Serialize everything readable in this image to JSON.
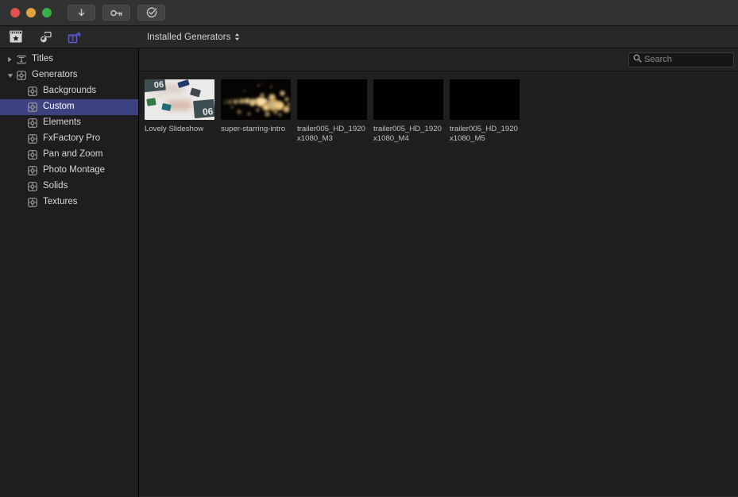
{
  "window": {
    "traffic_lights": [
      {
        "name": "close",
        "color": "#e0524a"
      },
      {
        "name": "minimize",
        "color": "#dfa23c"
      },
      {
        "name": "zoom",
        "color": "#36b14a"
      }
    ],
    "toolbar_buttons": [
      {
        "name": "download-button",
        "icon": "download-arrow-icon"
      },
      {
        "name": "license-key-button",
        "icon": "key-icon"
      },
      {
        "name": "check-updates-button",
        "icon": "check-circle-icon"
      }
    ]
  },
  "subbar": {
    "icons": [
      {
        "name": "clapboard-star-icon",
        "label": "Effects Browser"
      },
      {
        "name": "music-photo-icon",
        "label": "Music and Photos"
      },
      {
        "name": "titles-generators-icon",
        "label": "Titles and Generators"
      }
    ],
    "title": "Installed Generators",
    "popup_indicator": "chevron-updown-icon"
  },
  "search": {
    "placeholder": "Search",
    "value": "",
    "icon": "search-icon"
  },
  "sidebar": {
    "items": [
      {
        "label": "Titles",
        "level": 0,
        "disclosure": "collapsed",
        "icon": "titles-icon",
        "selected": false
      },
      {
        "label": "Generators",
        "level": 0,
        "disclosure": "expanded",
        "icon": "generator-icon",
        "selected": false
      },
      {
        "label": "Backgrounds",
        "level": 1,
        "disclosure": "none",
        "icon": "generator-icon",
        "selected": false
      },
      {
        "label": "Custom",
        "level": 1,
        "disclosure": "none",
        "icon": "generator-icon",
        "selected": true
      },
      {
        "label": "Elements",
        "level": 1,
        "disclosure": "none",
        "icon": "generator-icon",
        "selected": false
      },
      {
        "label": "FxFactory Pro",
        "level": 1,
        "disclosure": "none",
        "icon": "generator-icon",
        "selected": false
      },
      {
        "label": "Pan and Zoom",
        "level": 1,
        "disclosure": "none",
        "icon": "generator-icon",
        "selected": false
      },
      {
        "label": "Photo Montage",
        "level": 1,
        "disclosure": "none",
        "icon": "generator-icon",
        "selected": false
      },
      {
        "label": "Solids",
        "level": 1,
        "disclosure": "none",
        "icon": "generator-icon",
        "selected": false
      },
      {
        "label": "Textures",
        "level": 1,
        "disclosure": "none",
        "icon": "generator-icon",
        "selected": false
      }
    ],
    "selection_color": "#3c4380"
  },
  "grid": {
    "items": [
      {
        "label": "Lovely Slideshow",
        "thumb": "slideshow"
      },
      {
        "label": "super-starring-intro",
        "thumb": "bokeh"
      },
      {
        "label": "trailer005_HD_1920x1080_M3",
        "thumb": "black"
      },
      {
        "label": "trailer005_HD_1920x1080_M4",
        "thumb": "black"
      },
      {
        "label": "trailer005_HD_1920x1080_M5",
        "thumb": "black"
      }
    ]
  }
}
